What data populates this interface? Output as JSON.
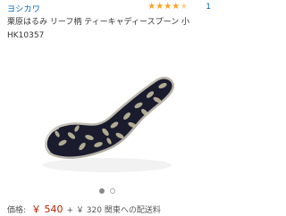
{
  "header": {
    "brand": "ヨシカワ",
    "rating": {
      "stars": 4.5,
      "review_count": "1"
    },
    "title": "栗原はるみ リーフ柄 ティーキャディースプーン 小 HK10357"
  },
  "image": {
    "icon": "product-image",
    "colors": {
      "spoon_dark": "#1b1b2e",
      "leaf": "#c9c3a4",
      "rim": "#cfcabc"
    }
  },
  "carousel": {
    "count": 2,
    "active_index": 0
  },
  "pricing": {
    "label": "価格:",
    "currency_price": "￥ 540",
    "shipping": "+ ￥ 320 関東への配送料"
  },
  "colors": {
    "link": "#0066c0",
    "price": "#b12704",
    "star": "#f5a623"
  }
}
